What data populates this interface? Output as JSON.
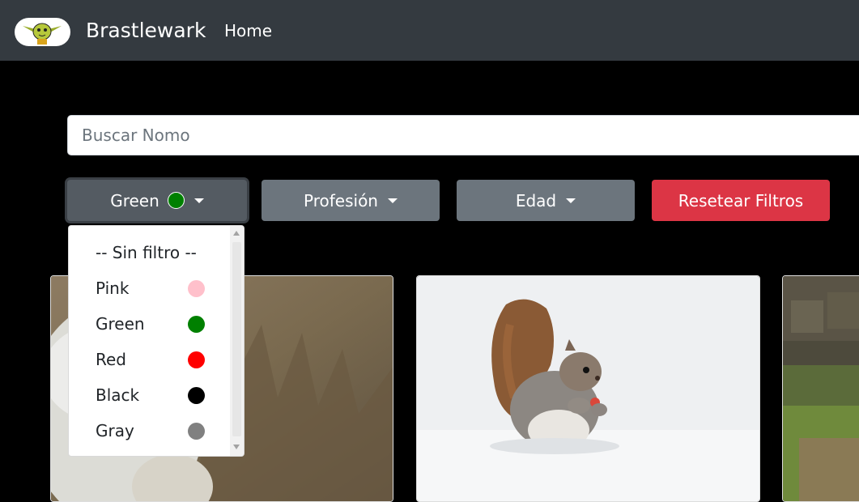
{
  "navbar": {
    "brand": "Brastlewark",
    "home": "Home",
    "logo_icon": "gnome-face-logo"
  },
  "search": {
    "placeholder": "Buscar Nomo",
    "value": ""
  },
  "filters": {
    "color_label": "Green",
    "color_selected": "#008000",
    "profession_label": "Profesión",
    "age_label": "Edad",
    "reset_label": "Resetear Filtros"
  },
  "dropdown": {
    "no_filter": "-- Sin filtro --",
    "options": [
      {
        "label": "Pink",
        "color": "#ffc0cb"
      },
      {
        "label": "Green",
        "color": "#008000"
      },
      {
        "label": "Red",
        "color": "#ff0000"
      },
      {
        "label": "Black",
        "color": "#000000"
      },
      {
        "label": "Gray",
        "color": "#808080"
      }
    ]
  },
  "cards": [
    {
      "image": "white-animal-photo"
    },
    {
      "image": "squirrel-in-snow-photo"
    },
    {
      "image": "grass-and-stone-photo"
    }
  ],
  "colors": {
    "navbar": "#343a40",
    "button_gray": "#6c757d",
    "button_red": "#dc3545"
  }
}
